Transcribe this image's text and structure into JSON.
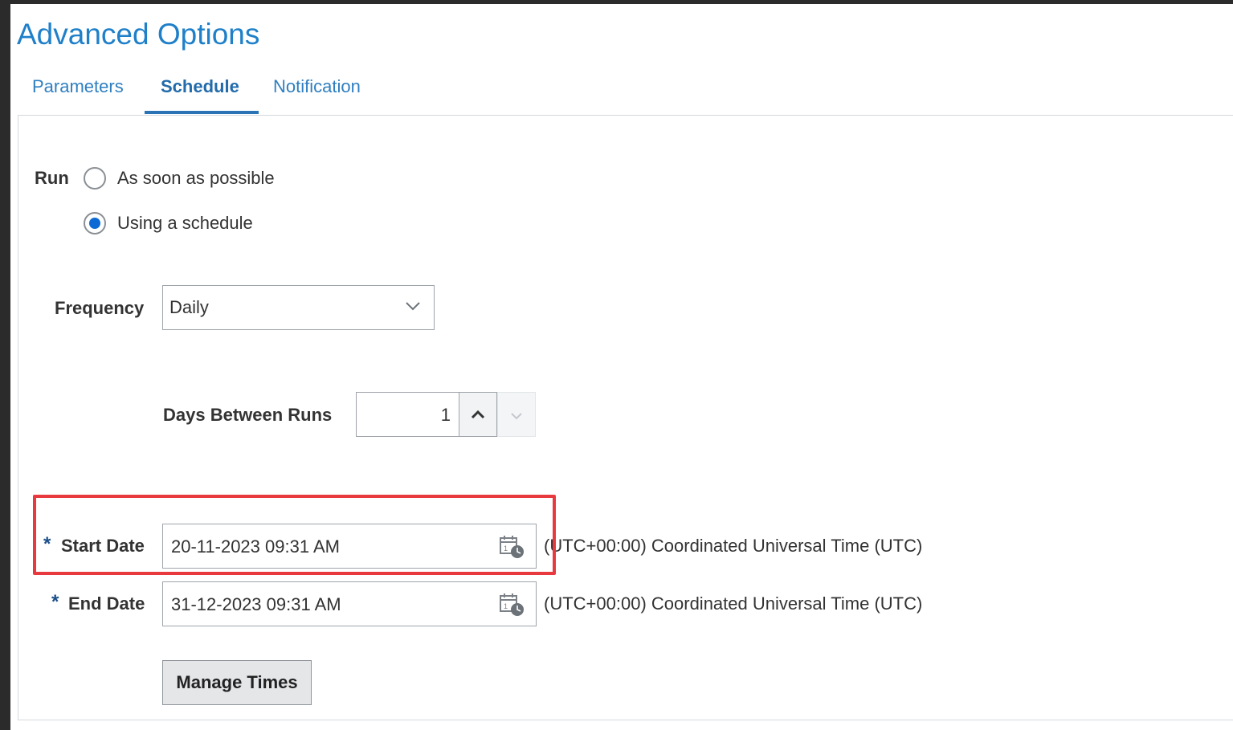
{
  "page": {
    "title": "Advanced Options"
  },
  "tabs": [
    {
      "label": "Parameters",
      "active": false
    },
    {
      "label": "Schedule",
      "active": true
    },
    {
      "label": "Notification",
      "active": false
    }
  ],
  "run": {
    "label": "Run",
    "options": [
      {
        "label": "As soon as possible",
        "selected": false
      },
      {
        "label": "Using a schedule",
        "selected": true
      }
    ]
  },
  "frequency": {
    "label": "Frequency",
    "value": "Daily",
    "icon": "chevron-down-icon"
  },
  "days_between_runs": {
    "label": "Days Between Runs",
    "value": "1"
  },
  "start_date": {
    "required_marker": "*",
    "label": "Start Date",
    "value": "20-11-2023 09:31 AM",
    "timezone": "(UTC+00:00) Coordinated Universal Time (UTC)",
    "icon": "calendar-clock-icon"
  },
  "end_date": {
    "required_marker": "*",
    "label": "End Date",
    "value": "31-12-2023 09:31 AM",
    "timezone": "(UTC+00:00) Coordinated Universal Time (UTC)",
    "icon": "calendar-clock-icon"
  },
  "manage_times": {
    "label": "Manage Times"
  },
  "colors": {
    "title": "#1f80c9",
    "tab": "#2f7fc1",
    "highlight": "#e8393f",
    "radio_selected": "#0d6ad4"
  }
}
